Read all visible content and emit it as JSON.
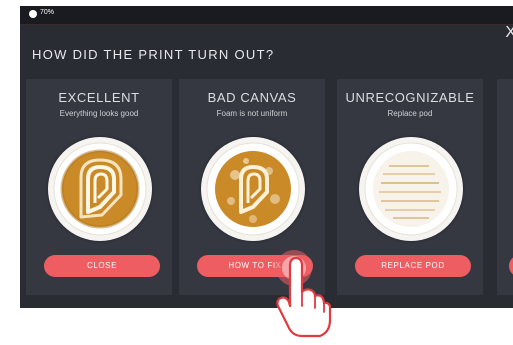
{
  "status_bar": {
    "battery": "70%"
  },
  "header": {
    "title": "HOW DID THE PRINT TURN OUT?",
    "close_glyph": "X"
  },
  "cards": [
    {
      "title": "EXCELLENT",
      "subtitle": "Everything looks good",
      "button": "CLOSE"
    },
    {
      "title": "BAD CANVAS",
      "subtitle": "Foam is not uniform",
      "button": "HOW TO FIX"
    },
    {
      "title": "UNRECOGNIZABLE",
      "subtitle": "Replace pod",
      "button": "REPLACE POD"
    }
  ],
  "colors": {
    "background": "#2a2c33",
    "card": "#353841",
    "accent": "#ee5d62",
    "coffee": "#c98a27"
  },
  "icons": {
    "pointer": "tap-hand-icon",
    "close": "close-icon",
    "battery": "battery-icon"
  }
}
